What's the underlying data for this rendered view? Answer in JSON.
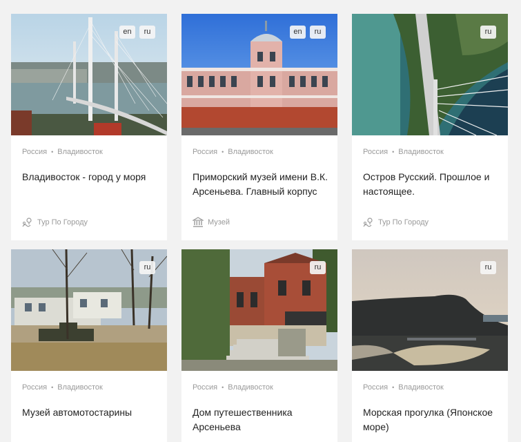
{
  "cards": [
    {
      "langs": [
        "en",
        "ru"
      ],
      "country": "Россия",
      "city": "Владивосток",
      "title": "Владивосток - город у моря",
      "category": "Тур По Городу",
      "category_icon": "map-pin-icon"
    },
    {
      "langs": [
        "en",
        "ru"
      ],
      "country": "Россия",
      "city": "Владивосток",
      "title": "Приморский музей имени В.К. Арсеньева. Главный корпус",
      "category": "Музей",
      "category_icon": "museum-icon"
    },
    {
      "langs": [
        "ru"
      ],
      "country": "Россия",
      "city": "Владивосток",
      "title": "Остров Русский. Прошлое и настоящее.",
      "category": "Тур По Городу",
      "category_icon": "map-pin-icon"
    },
    {
      "langs": [
        "ru"
      ],
      "country": "Россия",
      "city": "Владивосток",
      "title": "Музей автомотостарины"
    },
    {
      "langs": [
        "ru"
      ],
      "country": "Россия",
      "city": "Владивосток",
      "title": "Дом путешественника Арсеньева"
    },
    {
      "langs": [
        "ru"
      ],
      "country": "Россия",
      "city": "Владивосток",
      "title": "Морская прогулка (Японское море)"
    }
  ]
}
